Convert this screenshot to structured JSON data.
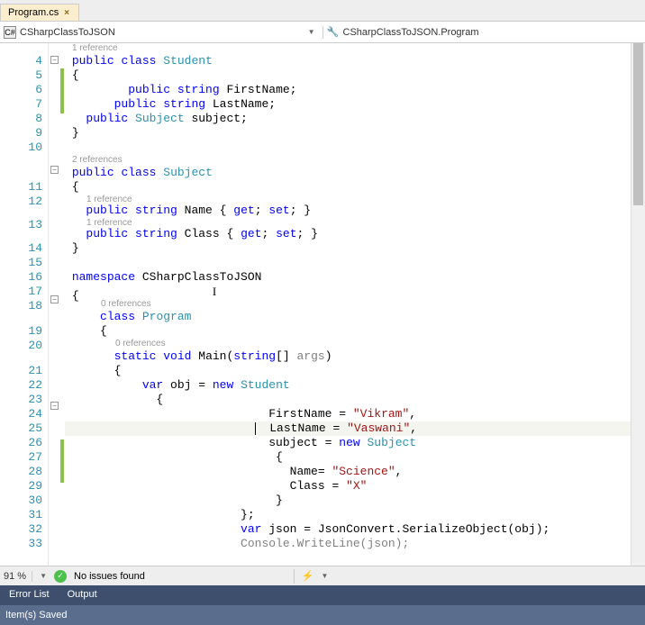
{
  "tab": {
    "name": "Program.cs",
    "close": "×"
  },
  "nav": {
    "left_icon": "C#",
    "left_text": "CSharpClassToJSON",
    "right_text": "CSharpClassToJSON.Program"
  },
  "gutter": [
    "4",
    "5",
    "6",
    "7",
    "8",
    "9",
    "10",
    "",
    "11",
    "12",
    "",
    "13",
    "",
    "14",
    "15",
    "16",
    "17",
    "18",
    "",
    "19",
    "20",
    "",
    "21",
    "22",
    "23",
    "24",
    "25",
    "26",
    "27",
    "28",
    "29",
    "30",
    "31",
    "32",
    "33",
    ""
  ],
  "refs": {
    "r1": "1 reference",
    "r2": "2 references",
    "r0": "0 references"
  },
  "code": {
    "l4": {
      "public": "public",
      "class": "class",
      "Student": "Student"
    },
    "l5": "{",
    "l6": {
      "public": "public",
      "string": "string",
      "FirstName": "FirstName;"
    },
    "l7": {
      "public": "public",
      "string": "string",
      "LastName": "LastName;"
    },
    "l8": {
      "public": "public",
      "Subject": "Subject",
      "subject": "subject;"
    },
    "l9": "}",
    "l11": {
      "public": "public",
      "class": "class",
      "Subject": "Subject"
    },
    "l12": "{",
    "l13": {
      "public": "public",
      "string": "string",
      "Name": "Name",
      "rest": " { ",
      "get": "get",
      "set": "set",
      "end": "; }"
    },
    "l14": {
      "public": "public",
      "string": "string",
      "Class": "Class",
      "rest": " { ",
      "get": "get",
      "set": "set",
      "end": "; }"
    },
    "l15": "}",
    "l17": {
      "namespace": "namespace",
      "CSharpClassToJSON": "CSharpClassToJSON"
    },
    "l18": "{",
    "l19": {
      "class": "class",
      "Program": "Program"
    },
    "l20": "{",
    "l21": {
      "static": "static",
      "void": "void",
      "Main": "Main(",
      "string": "string",
      "args": "args",
      ")": "[] ",
      ")end": ")"
    },
    "l22": "{",
    "l23": {
      "var": "var",
      "obj": " obj = ",
      "new": "new",
      "Student": "Student"
    },
    "l24": "{",
    "l25": {
      "FirstName": "FirstName = ",
      "val": "\"Vikram\"",
      "c": ","
    },
    "l26": {
      "LastName": "LastName = ",
      "val": "\"Vaswani\"",
      "c": ","
    },
    "l27": {
      "subject": "subject = ",
      "new": "new",
      "Subject": "Subject"
    },
    "l28": "{",
    "l29": {
      "Name": "Name= ",
      "val": "\"Science\"",
      "c": ","
    },
    "l30": {
      "Class": "Class = ",
      "val": "\"X\""
    },
    "l31": "}",
    "l32": "};",
    "l33": {
      "var": "var",
      "json": " json = JsonConvert.SerializeObject(obj);"
    },
    "l34": {
      "Console": "Console.WriteLine(json);"
    }
  },
  "status": {
    "zoom": "91 %",
    "issues": "No issues found"
  },
  "panels": {
    "error": "Error List",
    "output": "Output"
  },
  "bottom": "Item(s) Saved"
}
